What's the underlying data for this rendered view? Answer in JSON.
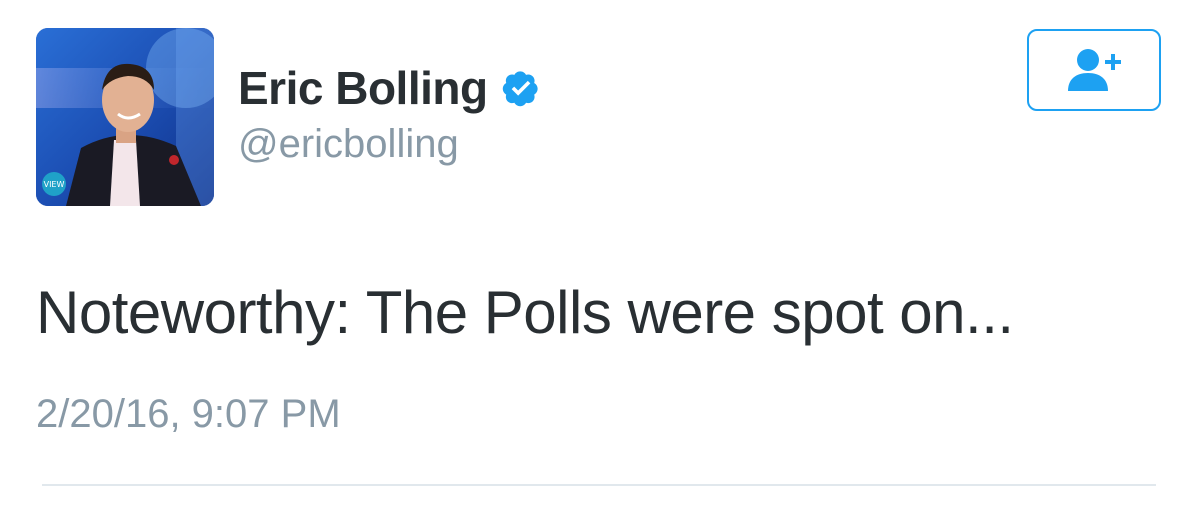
{
  "user": {
    "display_name": "Eric Bolling",
    "handle": "@ericbolling",
    "verified": true,
    "avatar_badge_text": "VIEW"
  },
  "follow_button": {
    "icon": "add-user-icon"
  },
  "tweet": {
    "text": "Noteworthy: The Polls were spot on...",
    "timestamp": "2/20/16, 9:07 PM"
  },
  "colors": {
    "accent": "#1da1f2",
    "text_primary": "#292f33",
    "text_secondary": "#8899a6",
    "divider": "#e1e8ed"
  }
}
